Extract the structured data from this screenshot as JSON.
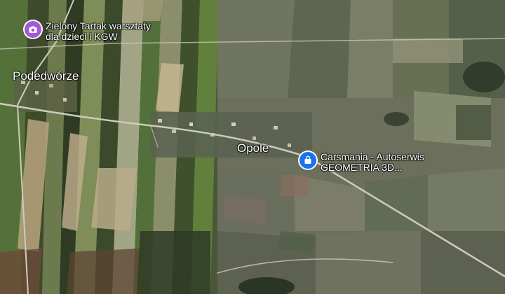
{
  "map": {
    "view": "satellite",
    "places": {
      "podedworze": {
        "label": "Podedwórze"
      },
      "opole": {
        "label": "Opole"
      }
    },
    "pois": {
      "zielony_tartak": {
        "line1": "Zielony Tartak warsztaty",
        "line2": "dla dzieci i KGW",
        "icon": "camera-icon",
        "color": "#a259d8"
      },
      "carsmania": {
        "line1": "Carsmania - Autoserwis",
        "line2": "GEOMETRIA 3D...",
        "icon": "shopping-bag-icon",
        "color": "#1a73e8"
      }
    },
    "colors": {
      "field_dark": "#2f3a24",
      "field_green": "#4f6a34",
      "field_light": "#9aa47a",
      "field_tan": "#b8a88a",
      "road": "#c9c4b8"
    }
  }
}
